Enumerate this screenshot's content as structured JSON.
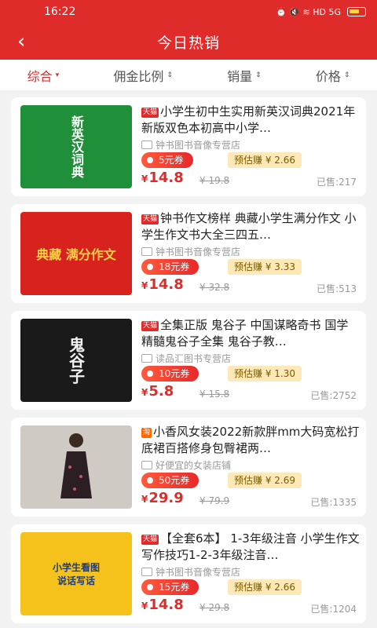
{
  "status": {
    "time": "16:22",
    "icons": "⏰ 🔇 ≋ HD 5G"
  },
  "header": {
    "back": "‹",
    "title": "今日热销"
  },
  "sort": [
    {
      "label": "综合",
      "arrow": "▾"
    },
    {
      "label": "佣金比例",
      "arrow": "⇕"
    },
    {
      "label": "销量",
      "arrow": "⇕"
    },
    {
      "label": "价格",
      "arrow": "⇕"
    }
  ],
  "products": [
    {
      "badge": "天猫",
      "title": "小学生初中生实用新英汉词典2021年新版双色本初高中小学…",
      "shop": "钟书图书音像专营店",
      "coupon": "5元券",
      "est": "预估赚 ¥ 2.66",
      "currency": "¥",
      "price": "14.8",
      "orig": "¥ 19.8",
      "sold": "已售:217",
      "cover_text": "新英汉词典",
      "cover_bg": "#1f8f3a"
    },
    {
      "badge": "天猫",
      "title": "钟书作文榜样 典藏小学生满分作文 小学生作文书大全三四五…",
      "shop": "钟书图书音像专营店",
      "coupon": "18元券",
      "est": "预估赚 ¥ 3.33",
      "currency": "¥",
      "price": "14.8",
      "orig": "¥ 32.8",
      "sold": "已售:513",
      "cover_text": "典藏 满分作文",
      "cover_bg": "#d8221e"
    },
    {
      "badge": "天猫",
      "title": "全集正版 鬼谷子 中国谋略奇书 国学精髓鬼谷子全集 鬼谷子教…",
      "shop": "读品汇图书专营店",
      "coupon": "10元券",
      "est": "预估赚 ¥ 1.30",
      "currency": "¥",
      "price": "5.8",
      "orig": "¥ 15.8",
      "sold": "已售:2752",
      "cover_text": "鬼谷子",
      "cover_bg": "#1a1a1a"
    },
    {
      "badge": "淘",
      "title": "小香风女装2022新款胖mm大码宽松打底裙百搭修身包臀裙两…",
      "shop": "好便宜的女装店铺",
      "coupon": "50元券",
      "est": "预估赚 ¥ 2.69",
      "currency": "¥",
      "price": "29.9",
      "orig": "¥ 79.9",
      "sold": "已售:1335",
      "cover_text": "",
      "cover_bg": "#cfcac4"
    },
    {
      "badge": "天猫",
      "title": "【全套6本】 1-3年级注音 小学生作文写作技巧1-2-3年级注音…",
      "shop": "钟书图书音像专营店",
      "coupon": "15元券",
      "est": "预估赚 ¥ 2.66",
      "currency": "¥",
      "price": "14.8",
      "orig": "¥ 29.8",
      "sold": "已售:1204",
      "cover_text": "小学生看图说话写话",
      "cover_bg": "#f4c21b"
    }
  ]
}
